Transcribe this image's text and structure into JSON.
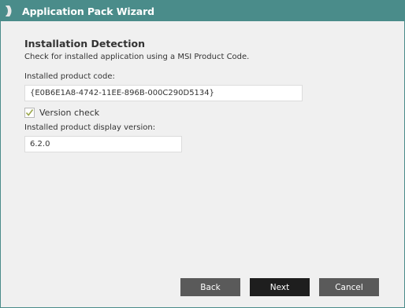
{
  "window": {
    "title": "Application Pack Wizard",
    "accent_color": "#4a8c8a",
    "icon": "app-logo-icon"
  },
  "section": {
    "title": "Installation Detection",
    "subtitle": "Check for installed application using a MSI Product Code."
  },
  "product_code": {
    "label": "Installed product code:",
    "value": "{E0B6E1A8-4742-11EE-896B-000C290D5134}"
  },
  "version_check": {
    "label": "Version check",
    "checked": true
  },
  "display_version": {
    "label": "Installed product display version:",
    "value": "6.2.0"
  },
  "buttons": {
    "back": "Back",
    "next": "Next",
    "cancel": "Cancel"
  }
}
